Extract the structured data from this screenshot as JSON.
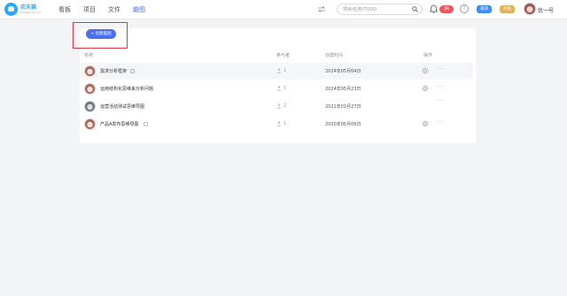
{
  "logo": {
    "title": "农夫猫",
    "subtitle": "minglance.com"
  },
  "nav": {
    "items": [
      "看板",
      "项目",
      "文件",
      "脑图"
    ],
    "active": "脑图"
  },
  "search": {
    "placeholder": "项目/任务/TODO"
  },
  "notifications": {
    "count": "36"
  },
  "help": {
    "label": "?"
  },
  "buttons": {
    "blue_label": "邀请",
    "gold_label": "升级",
    "create_label": "+ 创建脑图"
  },
  "user": {
    "name": "优一号"
  },
  "table": {
    "headers": {
      "name": "名称",
      "members": "参与者",
      "created": "创建时间",
      "ops": "操作"
    },
    "rows": [
      {
        "title": "需求分析框架",
        "members": "1",
        "date": "2024年05月04日",
        "has_gear": true
      },
      {
        "title": "运用结构化思维来分析问题",
        "members": "1",
        "date": "2024年05月23日",
        "has_gear": true
      },
      {
        "title": "运营活动测试思维导图",
        "members": "2",
        "date": "2021年01月27日",
        "has_gear": false
      },
      {
        "title": "产品A发布思维导图",
        "members": "1",
        "date": "2020年05月06日",
        "has_gear": true
      }
    ],
    "more_label": "···"
  },
  "colors": {
    "accent": "#4c6ef5",
    "badge": "#f2545b",
    "highlight": "#e8323f"
  }
}
